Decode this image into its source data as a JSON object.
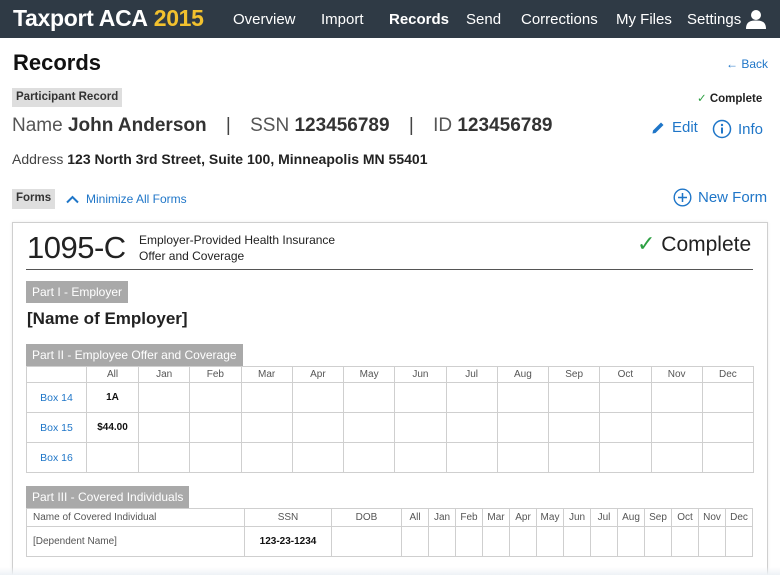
{
  "app": {
    "brand": "Taxport ACA",
    "year": "2015"
  },
  "nav": {
    "items": [
      {
        "label": "Overview"
      },
      {
        "label": "Import"
      },
      {
        "label": "Records"
      },
      {
        "label": "Send"
      },
      {
        "label": "Corrections"
      },
      {
        "label": "My Files"
      },
      {
        "label": "Settings"
      }
    ],
    "active": "Records",
    "user_icon": "user-icon"
  },
  "page": {
    "title": "Records",
    "back_label": "Back"
  },
  "participant": {
    "tag": "Participant Record",
    "status": "Complete",
    "name_label": "Name",
    "name": "John Anderson",
    "ssn_label": "SSN",
    "ssn": "123456789",
    "id_label": "ID",
    "id": "123456789",
    "edit_label": "Edit",
    "info_label": "Info",
    "address_label": "Address",
    "address": "123 North 3rd Street, Suite 100, Minneapolis MN 55401"
  },
  "forms": {
    "tag": "Forms",
    "minimize_label": "Minimize All Forms",
    "new_form_label": "New Form"
  },
  "form": {
    "code": "1095-C",
    "desc_line1": "Employer-Provided Health Insurance",
    "desc_line2": "Offer and Coverage",
    "status": "Complete",
    "part1": {
      "title": "Part I - Employer",
      "employer": "[Name of Employer]"
    },
    "part2": {
      "title": "Part II - Employee Offer and Coverage",
      "columns": [
        "",
        "All",
        "Jan",
        "Feb",
        "Mar",
        "Apr",
        "May",
        "Jun",
        "Jul",
        "Aug",
        "Sep",
        "Oct",
        "Nov",
        "Dec"
      ],
      "rows": [
        {
          "label": "Box 14",
          "all": "1A"
        },
        {
          "label": "Box 15",
          "all": "$44.00"
        },
        {
          "label": "Box 16",
          "all": ""
        }
      ]
    },
    "part3": {
      "title": "Part III - Covered Individuals",
      "columns": [
        "Name of Covered Individual",
        "SSN",
        "DOB",
        "All",
        "Jan",
        "Feb",
        "Mar",
        "Apr",
        "May",
        "Jun",
        "Jul",
        "Aug",
        "Sep",
        "Oct",
        "Nov",
        "Dec"
      ],
      "rows": [
        {
          "name": "[Dependent Name]",
          "ssn": "123-23-1234",
          "dob": ""
        }
      ]
    }
  },
  "colors": {
    "nav_bg": "#2f3a45",
    "brand_year": "#f2c12e",
    "link": "#1f76c8",
    "complete_check": "#2ea043",
    "part_tag": "#a9a9a9"
  }
}
